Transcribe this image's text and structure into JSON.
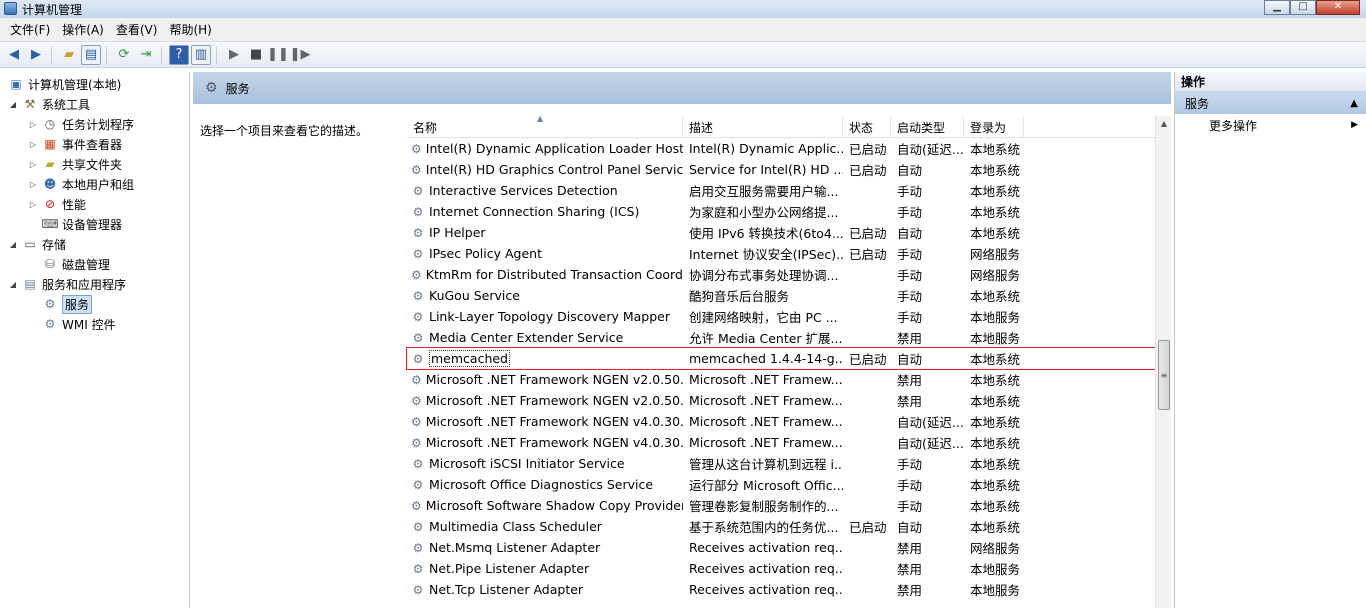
{
  "window": {
    "title": "计算机管理"
  },
  "menu": [
    "文件(F)",
    "操作(A)",
    "查看(V)",
    "帮助(H)"
  ],
  "tree": [
    {
      "label": "计算机管理(本地)",
      "level": 0,
      "expander": "",
      "icon": "computer-icon"
    },
    {
      "label": "系统工具",
      "level": 1,
      "expander": "◢",
      "icon": "tools-icon"
    },
    {
      "label": "任务计划程序",
      "level": 2,
      "expander": "▷",
      "icon": "clock-icon"
    },
    {
      "label": "事件查看器",
      "level": 2,
      "expander": "▷",
      "icon": "event-viewer-icon"
    },
    {
      "label": "共享文件夹",
      "level": 2,
      "expander": "▷",
      "icon": "shared-folder-icon"
    },
    {
      "label": "本地用户和组",
      "level": 2,
      "expander": "▷",
      "icon": "users-icon"
    },
    {
      "label": "性能",
      "level": 2,
      "expander": "▷",
      "icon": "performance-icon"
    },
    {
      "label": "设备管理器",
      "level": 2,
      "expander": "",
      "icon": "device-manager-icon"
    },
    {
      "label": "存储",
      "level": 1,
      "expander": "◢",
      "icon": "storage-icon"
    },
    {
      "label": "磁盘管理",
      "level": 2,
      "expander": "",
      "icon": "disk-icon"
    },
    {
      "label": "服务和应用程序",
      "level": 1,
      "expander": "◢",
      "icon": "services-apps-icon"
    },
    {
      "label": "服务",
      "level": 2,
      "expander": "",
      "icon": "gear-icon",
      "selected": true
    },
    {
      "label": "WMI 控件",
      "level": 2,
      "expander": "",
      "icon": "wmi-icon"
    }
  ],
  "main": {
    "header_title": "服务",
    "description_prompt": "选择一个项目来查看它的描述。",
    "columns": [
      "名称",
      "描述",
      "状态",
      "启动类型",
      "登录为"
    ],
    "rows": [
      {
        "name": "Intel(R) Dynamic Application Loader Host ...",
        "desc": "Intel(R) Dynamic Applic...",
        "status": "已启动",
        "start": "自动(延迟...",
        "logon": "本地系统"
      },
      {
        "name": "Intel(R) HD Graphics Control Panel Service",
        "desc": "Service for Intel(R) HD ...",
        "status": "已启动",
        "start": "自动",
        "logon": "本地系统"
      },
      {
        "name": "Interactive Services Detection",
        "desc": "启用交互服务需要用户输...",
        "status": "",
        "start": "手动",
        "logon": "本地系统"
      },
      {
        "name": "Internet Connection Sharing (ICS)",
        "desc": "为家庭和小型办公网络提...",
        "status": "",
        "start": "手动",
        "logon": "本地系统"
      },
      {
        "name": "IP Helper",
        "desc": "使用 IPv6 转换技术(6to4...",
        "status": "已启动",
        "start": "自动",
        "logon": "本地系统"
      },
      {
        "name": "IPsec Policy Agent",
        "desc": "Internet 协议安全(IPSec)...",
        "status": "已启动",
        "start": "手动",
        "logon": "网络服务"
      },
      {
        "name": "KtmRm for Distributed Transaction Coord...",
        "desc": "协调分布式事务处理协调...",
        "status": "",
        "start": "手动",
        "logon": "网络服务"
      },
      {
        "name": "KuGou Service",
        "desc": "酷狗音乐后台服务",
        "status": "",
        "start": "手动",
        "logon": "本地系统"
      },
      {
        "name": "Link-Layer Topology Discovery Mapper",
        "desc": "创建网络映射，它由 PC ...",
        "status": "",
        "start": "手动",
        "logon": "本地服务"
      },
      {
        "name": "Media Center Extender Service",
        "desc": "允许 Media Center 扩展...",
        "status": "",
        "start": "禁用",
        "logon": "本地服务"
      },
      {
        "name": "memcached",
        "desc": "memcached 1.4.4-14-g...",
        "status": "已启动",
        "start": "自动",
        "logon": "本地系统",
        "highlight": true
      },
      {
        "name": "Microsoft .NET Framework NGEN v2.0.50...",
        "desc": "Microsoft .NET Framew...",
        "status": "",
        "start": "禁用",
        "logon": "本地系统"
      },
      {
        "name": "Microsoft .NET Framework NGEN v2.0.50...",
        "desc": "Microsoft .NET Framew...",
        "status": "",
        "start": "禁用",
        "logon": "本地系统"
      },
      {
        "name": "Microsoft .NET Framework NGEN v4.0.30...",
        "desc": "Microsoft .NET Framew...",
        "status": "",
        "start": "自动(延迟...",
        "logon": "本地系统"
      },
      {
        "name": "Microsoft .NET Framework NGEN v4.0.30...",
        "desc": "Microsoft .NET Framew...",
        "status": "",
        "start": "自动(延迟...",
        "logon": "本地系统"
      },
      {
        "name": "Microsoft iSCSI Initiator Service",
        "desc": "管理从这台计算机到远程 i...",
        "status": "",
        "start": "手动",
        "logon": "本地系统"
      },
      {
        "name": "Microsoft Office Diagnostics Service",
        "desc": "运行部分 Microsoft Offic...",
        "status": "",
        "start": "手动",
        "logon": "本地系统"
      },
      {
        "name": "Microsoft Software Shadow Copy Provider",
        "desc": "管理卷影复制服务制作的...",
        "status": "",
        "start": "手动",
        "logon": "本地系统"
      },
      {
        "name": "Multimedia Class Scheduler",
        "desc": "基于系统范围内的任务优...",
        "status": "已启动",
        "start": "自动",
        "logon": "本地系统"
      },
      {
        "name": "Net.Msmq Listener Adapter",
        "desc": "Receives activation req...",
        "status": "",
        "start": "禁用",
        "logon": "网络服务"
      },
      {
        "name": "Net.Pipe Listener Adapter",
        "desc": "Receives activation req...",
        "status": "",
        "start": "禁用",
        "logon": "本地服务"
      },
      {
        "name": "Net.Tcp Listener Adapter",
        "desc": "Receives activation req...",
        "status": "",
        "start": "禁用",
        "logon": "本地服务"
      }
    ]
  },
  "actions": {
    "header": "操作",
    "section": "服务",
    "more": "更多操作"
  },
  "colors": {
    "highlight_border": "#e02424",
    "header_bg": "#a9c1dc"
  }
}
